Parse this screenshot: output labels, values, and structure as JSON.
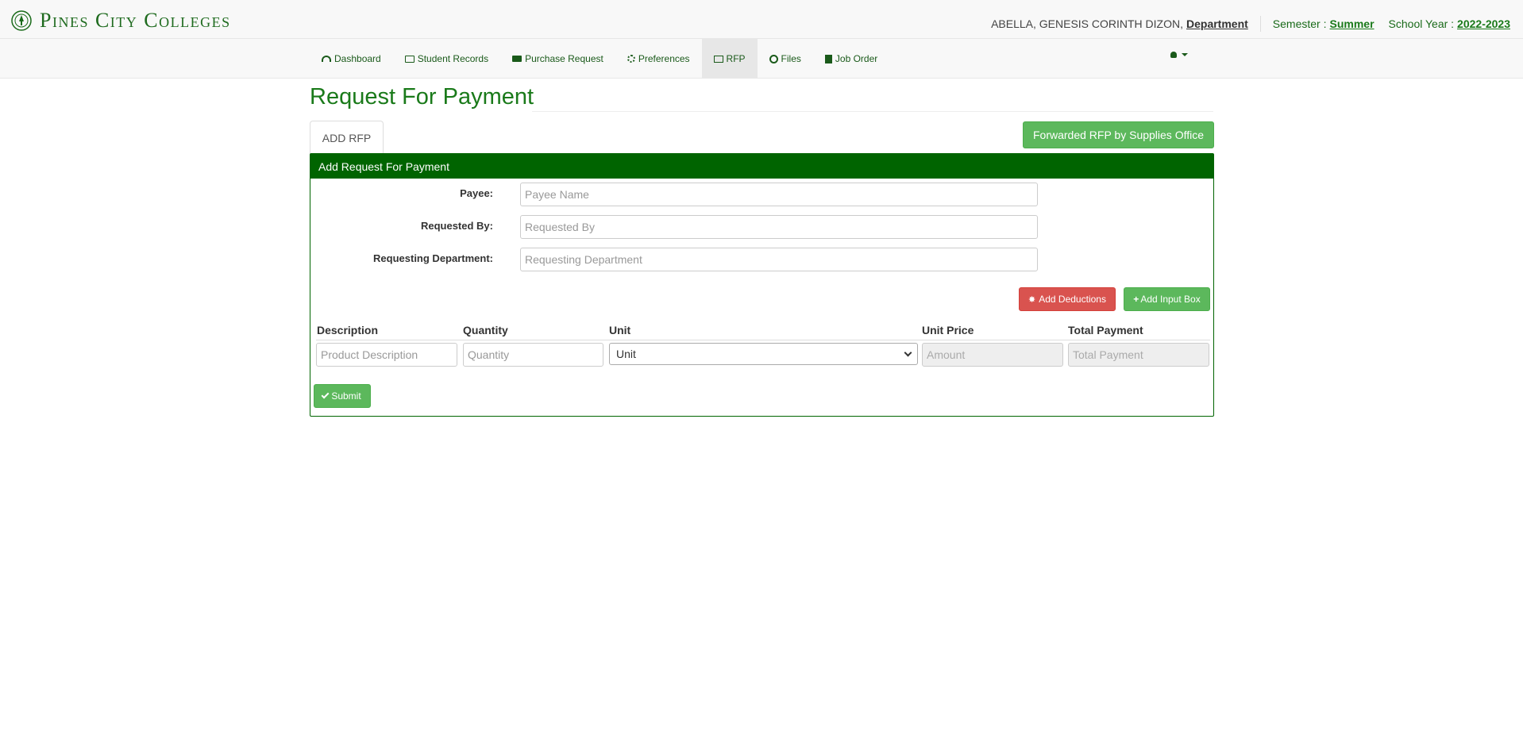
{
  "header": {
    "brand": "Pines City Colleges",
    "user_name": "ABELLA, GENESIS CORINTH DIZON,",
    "user_role": "Department",
    "semester_label": "Semester :",
    "semester_value": "Summer",
    "school_year_label": "School Year :",
    "school_year_value": "2022-2023"
  },
  "nav": {
    "items": [
      {
        "label": "Dashboard",
        "icon": "dashboard-icon"
      },
      {
        "label": "Student Records",
        "icon": "folder-open-icon"
      },
      {
        "label": "Purchase Request",
        "icon": "money-icon"
      },
      {
        "label": "Preferences",
        "icon": "gear-icon"
      },
      {
        "label": "RFP",
        "icon": "rfp-icon",
        "active": true
      },
      {
        "label": "Files",
        "icon": "arrow-circle-icon"
      },
      {
        "label": "Job Order",
        "icon": "file-icon"
      }
    ]
  },
  "page": {
    "title": "Request For Payment",
    "tab_add": "ADD RFP",
    "forward_button": "Forwarded RFP by Supplies Office",
    "panel_title": "Add Request For Payment"
  },
  "form": {
    "payee_label": "Payee:",
    "payee_placeholder": "Payee Name",
    "requested_by_label": "Requested By:",
    "requested_by_placeholder": "Requested By",
    "department_label": "Requesting Department:",
    "department_placeholder": "Requesting Department",
    "add_deductions": "Add Deductions",
    "add_input_box": "Add Input Box",
    "columns": {
      "description": "Description",
      "quantity": "Quantity",
      "unit": "Unit",
      "unit_price": "Unit Price",
      "total_payment": "Total Payment"
    },
    "row": {
      "description_placeholder": "Product Description",
      "quantity_placeholder": "Quantity",
      "unit_selected": "Unit",
      "amount_placeholder": "Amount",
      "total_placeholder": "Total Payment"
    },
    "submit": "Submit"
  },
  "colors": {
    "brand_green": "#006400",
    "success": "#5cb85c",
    "danger": "#d9534f"
  }
}
